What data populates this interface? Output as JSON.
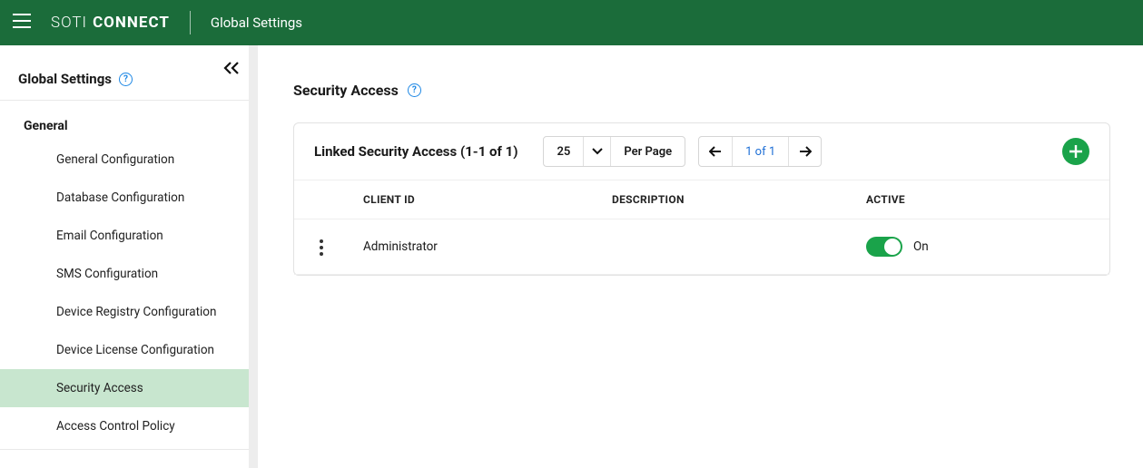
{
  "brand": {
    "thin": "SOTI",
    "bold": "CONNECT"
  },
  "topbar": {
    "title": "Global Settings"
  },
  "sidebar": {
    "title": "Global Settings",
    "group_label": "General",
    "items": [
      {
        "label": "General Configuration",
        "active": false
      },
      {
        "label": "Database Configuration",
        "active": false
      },
      {
        "label": "Email Configuration",
        "active": false
      },
      {
        "label": "SMS Configuration",
        "active": false
      },
      {
        "label": "Device Registry Configuration",
        "active": false
      },
      {
        "label": "Device License Configuration",
        "active": false
      },
      {
        "label": "Security Access",
        "active": true
      },
      {
        "label": "Access Control Policy",
        "active": false
      }
    ]
  },
  "page": {
    "title": "Security Access"
  },
  "panel": {
    "title": "Linked Security Access (1-1 of 1)",
    "page_size_value": "25",
    "page_size_label": "Per Page",
    "pager_text": "1 of 1"
  },
  "table": {
    "headers": {
      "client_id": "CLIENT ID",
      "description": "DESCRIPTION",
      "active": "ACTIVE"
    },
    "rows": [
      {
        "client_id": "Administrator",
        "description": "",
        "active_label": "On",
        "active": true
      }
    ]
  },
  "colors": {
    "brand_green": "#1b6c3a",
    "accent_green": "#1aa34a",
    "active_row_bg": "#c8e6cf",
    "link_blue": "#1e6fd6"
  }
}
